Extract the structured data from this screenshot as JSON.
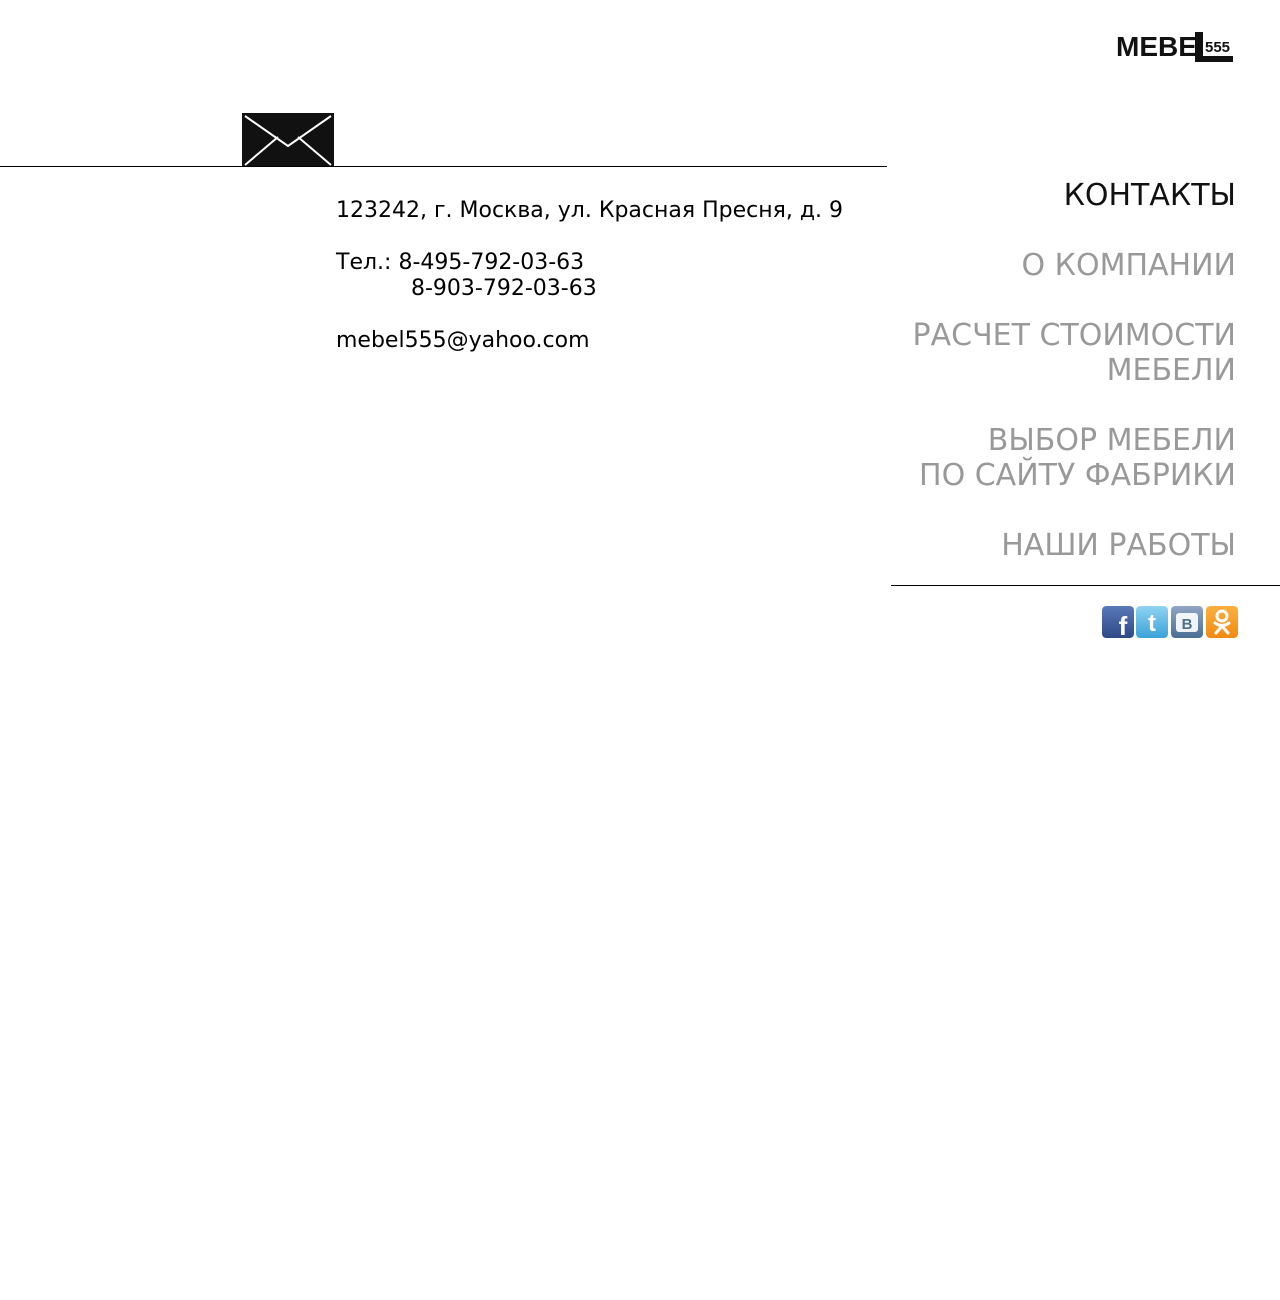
{
  "logo": {
    "text": "MEBE",
    "number": "555"
  },
  "contact": {
    "address": "123242, г. Москва, ул. Красная Пресня, д. 9",
    "phone_label": "Тел.:",
    "phone_1": "8-495-792-03-63",
    "phone_2": "8-903-792-03-63",
    "email": "mebel555@yahoo.com"
  },
  "nav": {
    "items": [
      {
        "lines": [
          "КОНТАКТЫ"
        ],
        "active": true
      },
      {
        "lines": [
          "О КОМПАНИИ"
        ],
        "active": false
      },
      {
        "lines": [
          "РАСЧЕТ СТОИМОСТИ",
          "МЕБЕЛИ"
        ],
        "active": false
      },
      {
        "lines": [
          "ВЫБОР МЕБЕЛИ",
          "ПО САЙТУ ФАБРИКИ"
        ],
        "active": false
      },
      {
        "lines": [
          "НАШИ РАБОТЫ"
        ],
        "active": false
      }
    ]
  },
  "social": {
    "icons": [
      "facebook-icon",
      "twitter-icon",
      "vkontakte-icon",
      "odnoklassniki-icon"
    ],
    "glyphs": {
      "facebook": "f",
      "twitter": "t",
      "vkontakte": "B"
    }
  },
  "colors": {
    "nav_active": "#111111",
    "nav_inactive": "#999999",
    "facebook": "#3b5998",
    "twitter": "#55acee",
    "vkontakte": "#4a6d94",
    "odnoklassniki": "#f7931e"
  }
}
